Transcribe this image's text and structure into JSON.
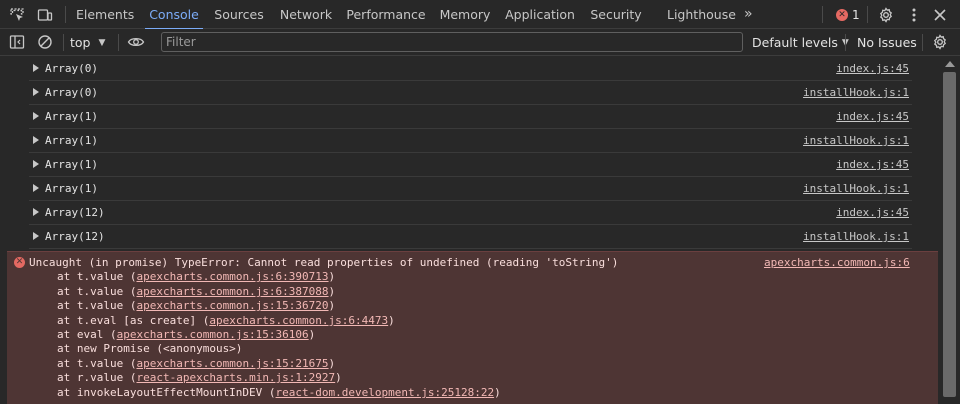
{
  "tabs": [
    {
      "label": "Elements"
    },
    {
      "label": "Console"
    },
    {
      "label": "Sources"
    },
    {
      "label": "Network"
    },
    {
      "label": "Performance"
    },
    {
      "label": "Memory"
    },
    {
      "label": "Application"
    },
    {
      "label": "Security"
    },
    {
      "label": "Lighthouse"
    }
  ],
  "more_tabs": "»",
  "error_count": "1",
  "toolbar": {
    "context": "top",
    "filter_placeholder": "Filter",
    "filter_value": "",
    "levels": "Default levels",
    "issues": "No Issues"
  },
  "messages": [
    {
      "text": "Array(0)",
      "source": "index.js:45"
    },
    {
      "text": "Array(0)",
      "source": "installHook.js:1"
    },
    {
      "text": "Array(1)",
      "source": "index.js:45"
    },
    {
      "text": "Array(1)",
      "source": "installHook.js:1"
    },
    {
      "text": "Array(1)",
      "source": "index.js:45"
    },
    {
      "text": "Array(1)",
      "source": "installHook.js:1"
    },
    {
      "text": "Array(12)",
      "source": "index.js:45"
    },
    {
      "text": "Array(12)",
      "source": "installHook.js:1"
    }
  ],
  "error": {
    "message": "Uncaught (in promise) TypeError: Cannot read properties of undefined (reading 'toString')",
    "source": "apexcharts.common.js:6",
    "stack": [
      {
        "prefix": "at t.value (",
        "link": "apexcharts.common.js:6:390713",
        "suffix": ")"
      },
      {
        "prefix": "at t.value (",
        "link": "apexcharts.common.js:6:387088",
        "suffix": ")"
      },
      {
        "prefix": "at t.value (",
        "link": "apexcharts.common.js:15:36720",
        "suffix": ")"
      },
      {
        "prefix": "at t.eval [as create] (",
        "link": "apexcharts.common.js:6:4473",
        "suffix": ")"
      },
      {
        "prefix": "at eval (",
        "link": "apexcharts.common.js:15:36106",
        "suffix": ")"
      },
      {
        "prefix": "at new Promise (<anonymous>)",
        "link": "",
        "suffix": ""
      },
      {
        "prefix": "at t.value (",
        "link": "apexcharts.common.js:15:21675",
        "suffix": ")"
      },
      {
        "prefix": "at r.value (",
        "link": "react-apexcharts.min.js:1:2927",
        "suffix": ")"
      },
      {
        "prefix": "at invokeLayoutEffectMountInDEV (",
        "link": "react-dom.development.js:25128:22",
        "suffix": ")"
      }
    ]
  },
  "icons": {
    "inspect": "inspect-element-icon",
    "device": "device-toolbar-icon",
    "settings": "gear-icon",
    "menu": "kebab-menu-icon",
    "close": "close-icon",
    "sidebar": "sidebar-toggle-icon",
    "clear": "clear-console-icon",
    "eye": "eye-icon"
  },
  "colors": {
    "accent": "#7cacf8",
    "error_bg": "#4e3534",
    "error_icon": "#e46962"
  }
}
